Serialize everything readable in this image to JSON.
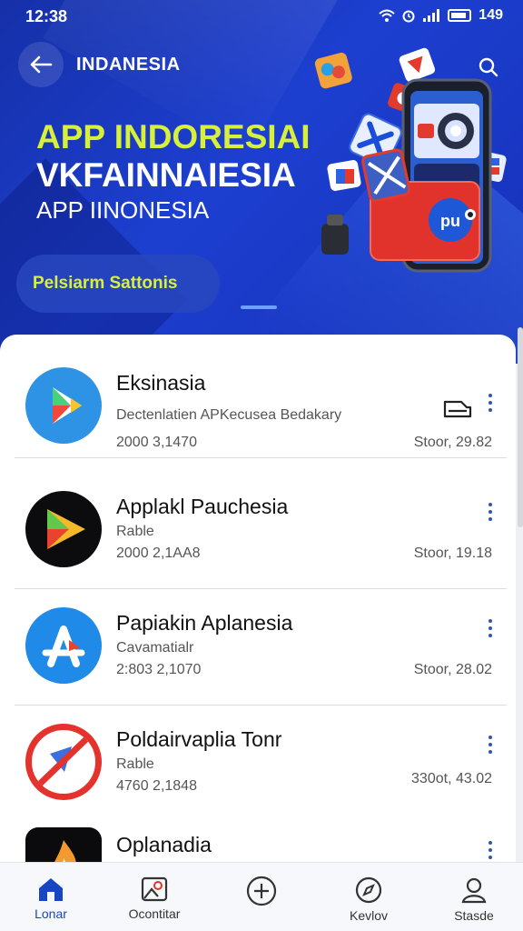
{
  "status_bar": {
    "time": "12:38",
    "battery": "149"
  },
  "header": {
    "title": "INDANESIA"
  },
  "hero": {
    "line1": "APP INDORESIAI",
    "line2": "VKFAINNAIESIA",
    "line3": "APP IINONESIA",
    "cta": "Pelsiarm Sattonis",
    "illustration_badge": "pu"
  },
  "apps": [
    {
      "name": "Eksinasia",
      "desc": "Dectenlatien APKecusea Bedakary",
      "date": "2000 3,1470",
      "size": "Stoor, 29.82",
      "icon": "play-store-icon"
    },
    {
      "name": "Applakl Pauchesia",
      "desc": "Rable",
      "date": "2000 2,1AA8",
      "size": "Stoor, 19.18",
      "icon": "play-store-dark-icon"
    },
    {
      "name": "Papiakin Aplanesia",
      "desc": "Cavamatialr",
      "date": "2:803 2,1070",
      "size": "Stoor, 28.02",
      "icon": "app-store-icon"
    },
    {
      "name": "Poldairvaplia Tonr",
      "desc": "Rable",
      "date": "4760 2,1848",
      "size": "330ot, 43.02",
      "icon": "blocked-app-icon"
    },
    {
      "name": "Oplanadia",
      "desc": "",
      "date": "",
      "size": "",
      "icon": "flame-app-icon"
    }
  ],
  "nav": [
    {
      "label": "Lonar",
      "icon": "home-icon"
    },
    {
      "label": "Ocontitar",
      "icon": "image-icon"
    },
    {
      "label": "",
      "icon": "add-icon"
    },
    {
      "label": "Kevlov",
      "icon": "compass-icon"
    },
    {
      "label": "Stasde",
      "icon": "profile-icon"
    }
  ],
  "colors": {
    "hero_bg": "#1d3fd0",
    "accent_lime": "#d8f03a",
    "nav_active": "#1745c4",
    "more_dots": "#2c5aa8"
  }
}
